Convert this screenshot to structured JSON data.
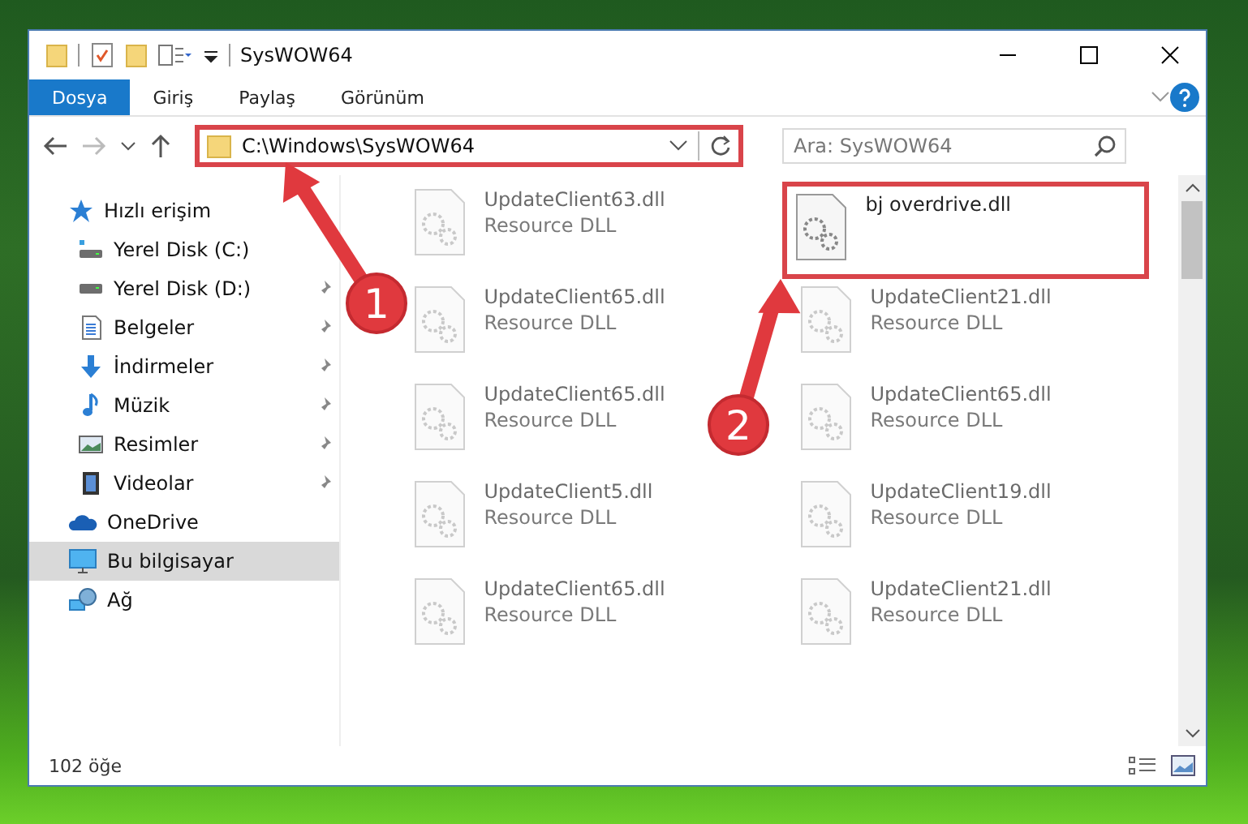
{
  "window": {
    "title": "SysWOW64"
  },
  "ribbon_tabs": [
    {
      "label": "Dosya",
      "selected": true
    },
    {
      "label": "Giriş",
      "selected": false
    },
    {
      "label": "Paylaş",
      "selected": false
    },
    {
      "label": "Görünüm",
      "selected": false
    }
  ],
  "address_bar": {
    "path": "C:\\Windows\\SysWOW64",
    "highlighted": true
  },
  "search": {
    "placeholder": "Ara: SysWOW64"
  },
  "sidebar": {
    "items": [
      {
        "label": "Hızlı erişim",
        "selected": false,
        "children": [
          {
            "label": "Yerel Disk (C:)"
          },
          {
            "label": "Yerel Disk (D:)",
            "pinned": true
          },
          {
            "label": "Belgeler",
            "pinned": true
          },
          {
            "label": "İndirmeler",
            "pinned": true
          },
          {
            "label": "Müzik",
            "pinned": true
          },
          {
            "label": "Resimler",
            "pinned": true
          },
          {
            "label": "Videolar",
            "pinned": true
          }
        ]
      },
      {
        "label": "OneDrive",
        "selected": false
      },
      {
        "label": "Bu bilgisayar",
        "selected": true
      },
      {
        "label": "Ağ",
        "selected": false
      }
    ]
  },
  "files": [
    {
      "name": "UpdateClient63.dll",
      "type": "Resource DLL",
      "blurred": true,
      "highlighted": false
    },
    {
      "name": "bj overdrive.dll",
      "blurred": false,
      "highlighted": true
    },
    {
      "name": "UpdateClient65.dll",
      "type": "Resource DLL",
      "blurred": true,
      "highlighted": false
    },
    {
      "name": "UpdateClient21.dll",
      "type": "Resource DLL",
      "blurred": true,
      "highlighted": false
    },
    {
      "name": "UpdateClient65.dll",
      "type": "Resource DLL",
      "blurred": true,
      "highlighted": false
    },
    {
      "name": "UpdateClient65.dll",
      "type": "Resource DLL",
      "blurred": true,
      "highlighted": false
    },
    {
      "name": "UpdateClient5.dll",
      "type": "Resource DLL",
      "blurred": true,
      "highlighted": false
    },
    {
      "name": "UpdateClient19.dll",
      "type": "Resource DLL",
      "blurred": true,
      "highlighted": false
    },
    {
      "name": "UpdateClient65.dll",
      "type": "Resource DLL",
      "blurred": true,
      "highlighted": false
    },
    {
      "name": "UpdateClient21.dll",
      "type": "Resource DLL",
      "blurred": true,
      "highlighted": false
    }
  ],
  "callouts": [
    {
      "label": "1"
    },
    {
      "label": "2"
    }
  ],
  "status_bar": {
    "item_count": "102 öğe"
  }
}
